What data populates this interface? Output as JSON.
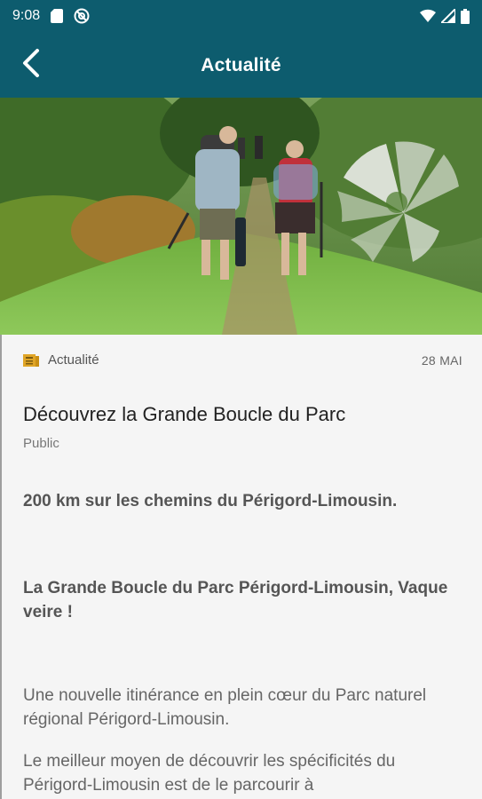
{
  "status_bar": {
    "time": "9:08"
  },
  "app_bar": {
    "title": "Actualité"
  },
  "meta": {
    "category": "Actualité",
    "date": "28 MAI"
  },
  "article": {
    "title": "Découvrez la Grande Boucle du Parc",
    "audience": "Public",
    "lead": "200 km sur les chemins du Périgord-Limousin.",
    "subhead": "La Grande Boucle du Parc Périgord-Limousin, Vaque veire !",
    "paragraph_1": "Une nouvelle itinérance en plein cœur du Parc naturel régional Périgord-Limousin.",
    "paragraph_2": "Le meilleur moyen de découvrir les spécificités du Périgord-Limousin est de le parcourir à"
  },
  "colors": {
    "primary": "#0d5c6e",
    "background": "#f5f5f5",
    "category_icon": "#e0a526"
  },
  "icons": [
    "sd-card-icon",
    "no-data-icon",
    "wifi-icon",
    "signal-icon",
    "battery-icon",
    "back-arrow-icon",
    "newspaper-icon"
  ]
}
